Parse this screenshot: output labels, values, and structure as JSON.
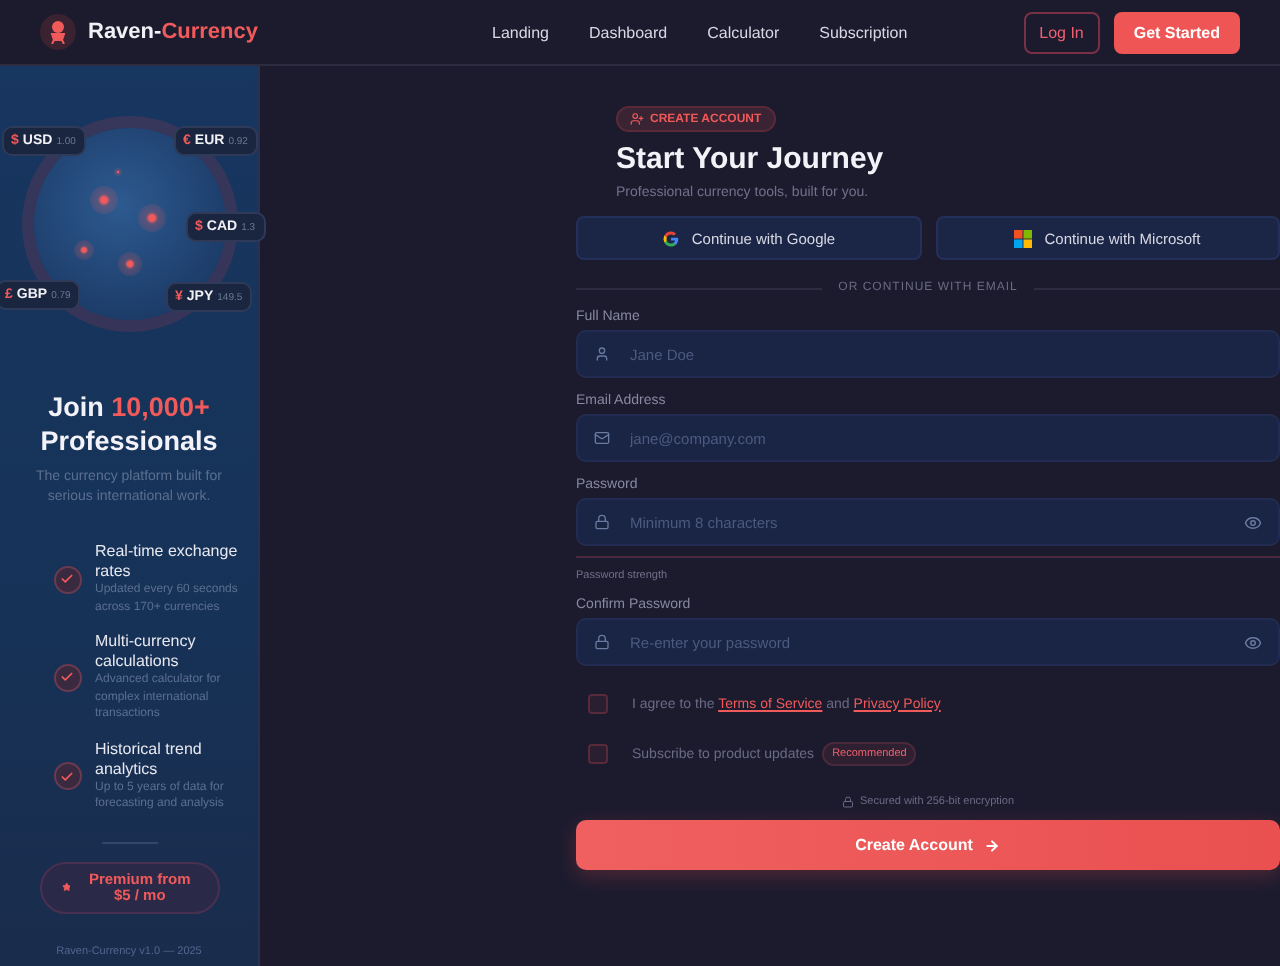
{
  "header": {
    "brand": {
      "first": "Raven-",
      "second": "Currency"
    },
    "nav": [
      {
        "label": "Landing"
      },
      {
        "label": "Dashboard"
      },
      {
        "label": "Calculator"
      },
      {
        "label": "Subscription"
      }
    ],
    "login": "Log In",
    "cta": "Get Started"
  },
  "sidebar": {
    "currencies": [
      {
        "symbol": "$",
        "code": "USD",
        "rate": "1.00"
      },
      {
        "symbol": "€",
        "code": "EUR",
        "rate": "0.92"
      },
      {
        "symbol": "$",
        "code": "CAD",
        "rate": "1.3"
      },
      {
        "symbol": "£",
        "code": "GBP",
        "rate": "0.79"
      },
      {
        "symbol": "¥",
        "code": "JPY",
        "rate": "149.5"
      }
    ],
    "heading": {
      "lead": "Join ",
      "accent": "10,000+",
      "rest": "Professionals"
    },
    "description": "The currency platform built for serious international work.",
    "features": [
      {
        "title": "Real-time exchange rates",
        "detail": "Updated every 60 seconds across 170+ currencies"
      },
      {
        "title": "Multi-currency calculations",
        "detail": "Advanced calculator for complex international transactions"
      },
      {
        "title": "Historical trend analytics",
        "detail": "Up to 5 years of data for forecasting and analysis"
      }
    ],
    "premium": "Premium from $5 / mo",
    "footer": "Raven-Currency v1.0 — 2025"
  },
  "form": {
    "badge": "CREATE ACCOUNT",
    "title": "Start Your Journey",
    "subtitle": "Professional currency tools, built for you.",
    "social": [
      {
        "kind": "google",
        "label": "Continue with Google"
      },
      {
        "kind": "microsoft",
        "label": "Continue with Microsoft"
      }
    ],
    "divider": "OR CONTINUE WITH EMAIL",
    "fields": [
      {
        "kind": "name",
        "label": "Full Name",
        "placeholder": "Jane Doe"
      },
      {
        "kind": "email",
        "label": "Email Address",
        "placeholder": "jane@company.com"
      },
      {
        "kind": "password",
        "label": "Password",
        "placeholder": "Minimum 8 characters"
      },
      {
        "kind": "strength",
        "label": "Password strength"
      },
      {
        "kind": "password",
        "label": "Confirm Password",
        "placeholder": "Re-enter your password"
      }
    ],
    "agree": {
      "checked": false,
      "text": "I agree to the ",
      "terms": "Terms of Service",
      "and": " and ",
      "privacy": "Privacy Policy"
    },
    "subscribe": {
      "checked": false,
      "text": "Subscribe to product updates",
      "tag": "Recommended"
    },
    "secure": "Secured with 256-bit encryption",
    "submit": "Create Account"
  }
}
